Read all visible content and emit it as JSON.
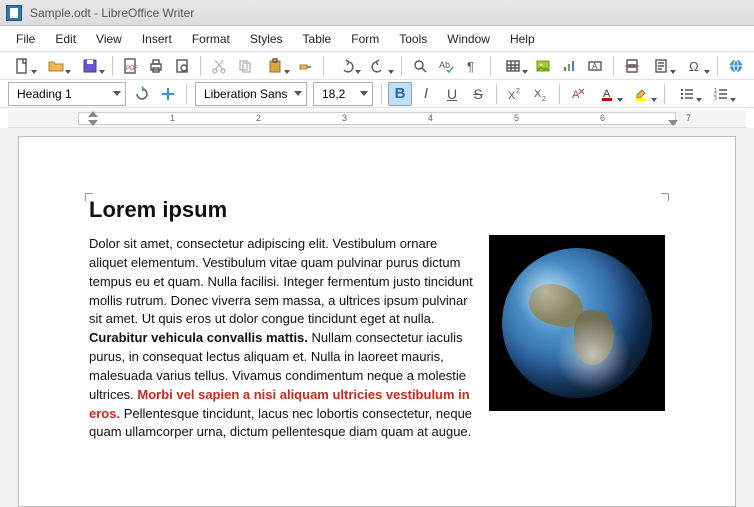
{
  "titlebar": {
    "text": "Sample.odt - LibreOffice Writer"
  },
  "menu": [
    "File",
    "Edit",
    "View",
    "Insert",
    "Format",
    "Styles",
    "Table",
    "Form",
    "Tools",
    "Window",
    "Help"
  ],
  "toolbar2": {
    "para_style": "Heading 1",
    "font_name": "Liberation Sans",
    "font_size": "18,2",
    "bold": "B",
    "italic": "I",
    "underline": "U",
    "strike": "S"
  },
  "ruler_numbers": [
    "1",
    "2",
    "3",
    "4",
    "5",
    "6",
    "7"
  ],
  "document": {
    "heading": "Lorem ipsum",
    "p1a": "Dolor sit amet, consectetur adipiscing elit. Vestibulum ornare aliquet elementum. Vestibulum vitae quam pulvinar purus dictum tempus eu et quam. Nulla facilisi. Integer fermentum justo tincidunt mollis rutrum. Donec viverra sem massa, a ultrices ipsum pulvinar sit amet. Ut quis eros ut dolor congue tincidunt eget at nulla. ",
    "p1b": "Curabitur vehicula convallis mattis.",
    "p1c": " Nullam consectetur iaculis purus, in consequat lectus aliquam et. Nulla in laoreet mauris, malesuada varius tellus. Vivamus condimentum neque a molestie ultrices. ",
    "p1d": "Morbi vel sapien a nisi aliquam ultricies vestibulum in eros.",
    "p1e": " Pellentesque tincidunt, lacus nec lobortis consectetur, neque quam ullamcorper urna, dictum pellentesque diam quam at augue."
  }
}
